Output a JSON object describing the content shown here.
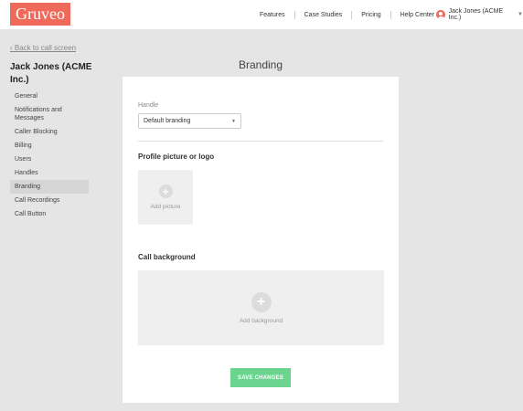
{
  "brand": {
    "logo_text": "Gruveo",
    "accent": "#f06a5b",
    "success": "#6bd58f"
  },
  "nav": {
    "items": [
      "Features",
      "Case Studies",
      "Pricing",
      "Help Center"
    ],
    "user_label": "Jack Jones (ACME Inc.)",
    "user_icon": "user-avatar-icon",
    "chevron_icon": "chevron-down-icon"
  },
  "sidebar": {
    "back_link": "‹ Back to call screen",
    "account_name": "Jack Jones (ACME Inc.)",
    "items": [
      {
        "label": "General",
        "active": false
      },
      {
        "label": "Notifications and Messages",
        "active": false
      },
      {
        "label": "Caller Blocking",
        "active": false
      },
      {
        "label": "Billing",
        "active": false
      },
      {
        "label": "Users",
        "active": false
      },
      {
        "label": "Handles",
        "active": false
      },
      {
        "label": "Branding",
        "active": true
      },
      {
        "label": "Call Recordings",
        "active": false
      },
      {
        "label": "Call Button",
        "active": false
      }
    ]
  },
  "main": {
    "title": "Branding",
    "handle": {
      "label": "Handle",
      "selected": "Default branding"
    },
    "profile": {
      "title": "Profile picture or logo",
      "add_text": "Add picture"
    },
    "background": {
      "title": "Call background",
      "add_text": "Add background"
    },
    "save_label": "SAVE CHANGES"
  }
}
